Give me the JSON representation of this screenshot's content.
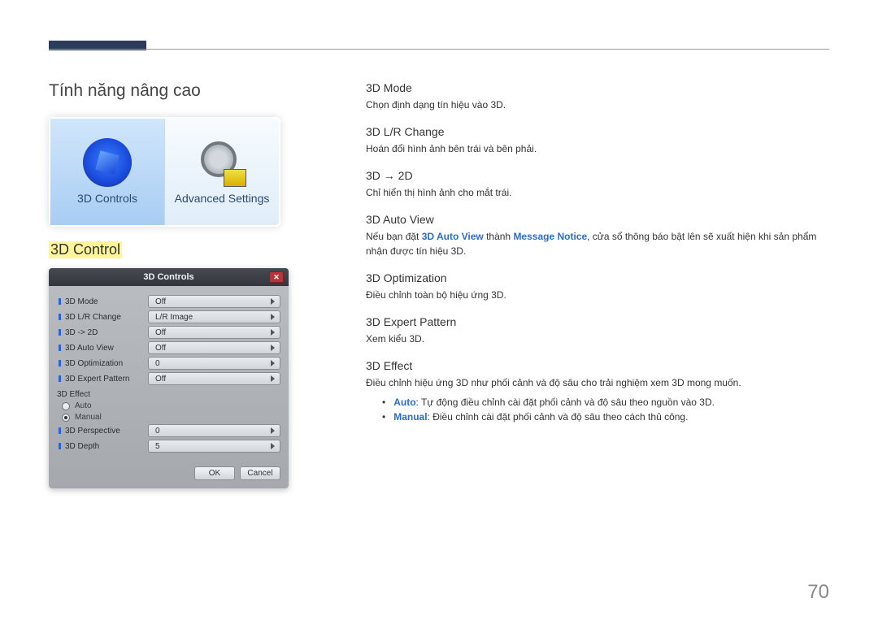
{
  "section_title": "Tính năng nâng cao",
  "feature_image": {
    "item_a_label": "3D Controls",
    "item_b_label": "Advanced Settings"
  },
  "highlighted_heading": "3D Control",
  "dialog": {
    "title": "3D Controls",
    "close_symbol": "✕",
    "rows": [
      {
        "label": "3D Mode",
        "value": "Off"
      },
      {
        "label": "3D L/R Change",
        "value": "L/R Image"
      },
      {
        "label": "3D -> 2D",
        "value": "Off"
      },
      {
        "label": "3D Auto View",
        "value": "Off"
      },
      {
        "label": "3D Optimization",
        "value": "0"
      },
      {
        "label": "3D Expert Pattern",
        "value": "Off"
      }
    ],
    "effect_section_label": "3D Effect",
    "radio_auto": "Auto",
    "radio_manual": "Manual",
    "sub_rows": [
      {
        "label": "3D Perspective",
        "value": "0"
      },
      {
        "label": "3D Depth",
        "value": "5"
      }
    ],
    "ok_label": "OK",
    "cancel_label": "Cancel"
  },
  "right": {
    "mode_h": "3D Mode",
    "mode_d": "Chọn định dạng tín hiệu vào 3D.",
    "lr_h": "3D L/R Change",
    "lr_d": "Hoán đổi hình ảnh bên trái và bên phải.",
    "to2d_h": "3D → 2D",
    "to2d_d": "Chỉ hiển thị hình ảnh cho mắt trái.",
    "auto_h": "3D Auto View",
    "auto_pre": "Nếu bạn đặt ",
    "auto_kw1": "3D Auto View",
    "auto_mid": " thành ",
    "auto_kw2": "Message Notice",
    "auto_post": ", cửa sổ thông báo bật lên sẽ xuất hiện khi sản phẩm nhận được tín hiệu 3D.",
    "opt_h": "3D Optimization",
    "opt_d": "Điều chỉnh toàn bộ hiệu ứng 3D.",
    "exp_h": "3D Expert Pattern",
    "exp_d": "Xem kiểu 3D.",
    "eff_h": "3D Effect",
    "eff_d": "Điều chỉnh hiệu ứng 3D như phối cảnh và độ sâu cho trải nghiệm xem 3D mong muốn.",
    "bullet_auto_kw": "Auto",
    "bullet_auto_txt": ": Tự động điều chỉnh cài đặt phối cảnh và độ sâu theo nguồn vào 3D.",
    "bullet_manual_kw": "Manual",
    "bullet_manual_txt": ": Điều chỉnh cài đặt phối cảnh và độ sâu theo cách thủ công."
  },
  "page_number": "70"
}
